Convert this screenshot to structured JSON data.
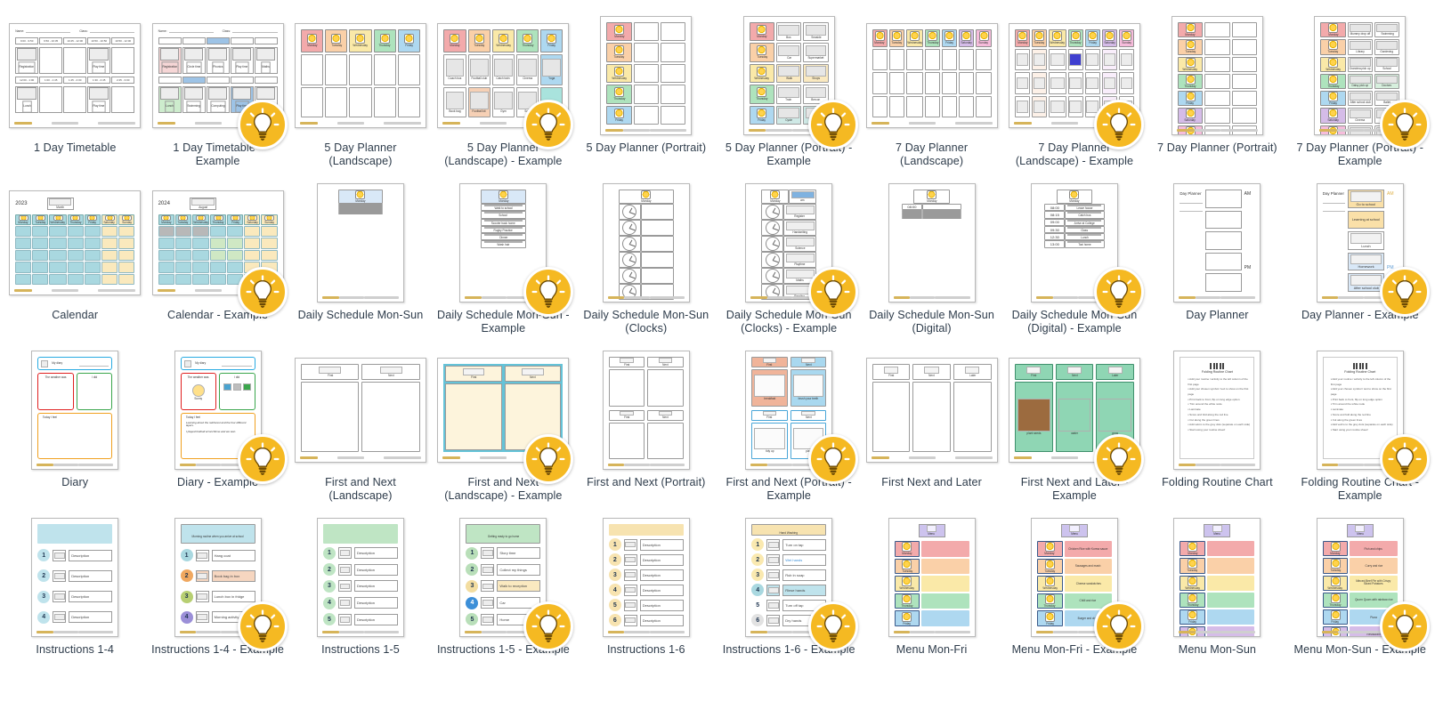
{
  "gallery": {
    "view": "template-thumbnail-grid",
    "columns": 10,
    "example_badge_icon": "lightbulb-icon",
    "items": [
      {
        "caption": "1 Day Timetable",
        "orientation": "landscape",
        "kind": "timetable",
        "example": false,
        "fields": {
          "name_label": "Name:",
          "class_label": "Class:",
          "time_slots_row1": [
            "9:00 - 9:50",
            "9:50 - 10:35",
            "10:45 - 12:00",
            "10:50 - 10:50",
            "10:50 - 12:00"
          ],
          "time_slots_row2": [
            "12:00 - 1:00",
            "1:00 - 1:45",
            "1:45 - 2:30",
            "1:30 - 2:45",
            "2:45 - 3:00"
          ],
          "cells_row1": [
            "Registration",
            "",
            "",
            "Play time",
            ""
          ],
          "cells_row2": [
            "Lunch",
            "",
            "",
            "Play time",
            ""
          ]
        }
      },
      {
        "caption": "1 Day Timetable - Example",
        "orientation": "landscape",
        "kind": "timetable",
        "example": true,
        "fields": {
          "name_label": "Name:",
          "class_label": "Class:",
          "cells_row1": [
            "Registration",
            "Circle time",
            "Phonics",
            "Play time",
            "Maths"
          ],
          "cells_row2": [
            "Lunch",
            "Swimming",
            "Computing",
            "Play time",
            "PE"
          ]
        }
      },
      {
        "caption": "5 Day Planner (Landscape)",
        "orientation": "landscape",
        "kind": "planner5-land",
        "example": false,
        "fields": {
          "days": [
            "Monday",
            "Tuesday",
            "Wednesday",
            "Thursday",
            "Friday"
          ],
          "rows": 2
        }
      },
      {
        "caption": "5 Day Planner (Landscape) - Example",
        "orientation": "landscape",
        "kind": "planner5-land",
        "example": true,
        "fields": {
          "days": [
            "Monday",
            "Tuesday",
            "Wednesday",
            "Thursday",
            "Friday"
          ],
          "rows": 2,
          "entries_row1": [
            "Coach bus",
            "Football club",
            "Catch train",
            "Cinema",
            "Yoga"
          ],
          "entries_row2": [
            "Book bag",
            "Football kit",
            "Gym",
            "Swim",
            ""
          ]
        }
      },
      {
        "caption": "5 Day Planner (Portrait)",
        "orientation": "portrait",
        "kind": "planner5-port",
        "example": false,
        "fields": {
          "days": [
            "Monday",
            "Tuesday",
            "Wednesday",
            "Thursday",
            "Friday"
          ],
          "cols": 2
        }
      },
      {
        "caption": "5 Day Planner (Portrait) - Example",
        "orientation": "portrait",
        "kind": "planner5-port",
        "example": true,
        "fields": {
          "days": [
            "Monday",
            "Tuesday",
            "Wednesday",
            "Thursday",
            "Friday"
          ],
          "entries": [
            [
              "Bus",
              "Seaside"
            ],
            [
              "Car",
              "Supermarket"
            ],
            [
              "Walk",
              "Shops"
            ],
            [
              "Train",
              "Brecon"
            ],
            [
              "Cycle",
              "Park"
            ]
          ]
        }
      },
      {
        "caption": "7 Day Planner (Landscape)",
        "orientation": "landscape",
        "kind": "planner7-land",
        "example": false,
        "fields": {
          "days": [
            "Monday",
            "Tuesday",
            "Wednesday",
            "Thursday",
            "Friday",
            "Saturday",
            "Sunday"
          ],
          "rows": 3
        }
      },
      {
        "caption": "7 Day Planner (Landscape) - Example",
        "orientation": "landscape",
        "kind": "planner7-land",
        "example": true,
        "fields": {
          "days": [
            "Monday",
            "Tuesday",
            "Wednesday",
            "Thursday",
            "Friday",
            "Saturday",
            "Sunday"
          ],
          "rows": 3
        }
      },
      {
        "caption": "7 Day Planner (Portrait)",
        "orientation": "portrait",
        "kind": "planner7-port",
        "example": false,
        "fields": {
          "days": [
            "Monday",
            "Tuesday",
            "Wednesday",
            "Thursday",
            "Friday",
            "Saturday",
            "Sunday"
          ],
          "cols": 2
        }
      },
      {
        "caption": "7 Day Planner (Portrait) - Example",
        "orientation": "portrait",
        "kind": "planner7-port",
        "example": true,
        "fields": {
          "days": [
            "Monday",
            "Tuesday",
            "Wednesday",
            "Thursday",
            "Friday",
            "Saturday",
            "Sunday"
          ],
          "entries": [
            [
              "Mummy drop off",
              "Swimming"
            ],
            [
              "Library",
              "Gardening"
            ],
            [
              "Grandma pick up",
              "School"
            ],
            [
              "Daisy pick up",
              "Doctors"
            ],
            [
              "After school club",
              "Ballet"
            ],
            [
              "Cinema",
              "Trampoline"
            ],
            [
              "Park",
              "Swim"
            ]
          ]
        }
      },
      {
        "caption": "Calendar",
        "orientation": "landscape",
        "kind": "calendar",
        "example": false,
        "fields": {
          "year": "2023",
          "month_label": "Month",
          "days": [
            "Monday",
            "Tuesday",
            "Wednesday",
            "Thursday",
            "Friday",
            "Saturday",
            "Sunday"
          ],
          "rows": 5
        }
      },
      {
        "caption": "Calendar - Example",
        "orientation": "landscape",
        "kind": "calendar",
        "example": true,
        "fields": {
          "year": "2024",
          "month_label": "August",
          "days": [
            "Monday",
            "Tuesday",
            "Wednesday",
            "Thursday",
            "Friday",
            "Saturday",
            "Sunday"
          ],
          "rows": 5
        }
      },
      {
        "caption": "Daily Schedule Mon-Sun",
        "orientation": "portrait-n",
        "kind": "daily",
        "example": false,
        "fields": {
          "day": "Monday",
          "rows": 6
        }
      },
      {
        "caption": "Daily Schedule Mon-Sun - Example",
        "orientation": "portrait-n",
        "kind": "daily",
        "example": true,
        "fields": {
          "day": "Monday",
          "rows": 6,
          "entries": [
            "Walk to school",
            "School",
            "Scooter back home",
            "Rugby Practice",
            "Dinner",
            "Wash hair"
          ]
        }
      },
      {
        "caption": "Daily Schedule Mon-Sun (Clocks)",
        "orientation": "portrait-n",
        "kind": "daily-clocks",
        "example": false,
        "fields": {
          "day": "Monday",
          "rows": 6
        }
      },
      {
        "caption": "Daily Schedule Mon-Sun (Clocks) - Example",
        "orientation": "portrait-n",
        "kind": "daily-clocks",
        "example": true,
        "fields": {
          "day": "Monday",
          "am_label": "am",
          "rows": 6,
          "entries": [
            "Register",
            "Handwriting",
            "Science",
            "Playtime",
            "Maths",
            "Reading"
          ]
        }
      },
      {
        "caption": "Daily Schedule Mon-Sun (Digital)",
        "orientation": "portrait-n",
        "kind": "daily-digital",
        "example": false,
        "fields": {
          "day": "Monday",
          "times": [
            "08:00",
            "",
            "",
            "",
            "",
            ""
          ]
        }
      },
      {
        "caption": "Daily Schedule Mon-Sun (Digital) - Example",
        "orientation": "portrait-n",
        "kind": "daily-digital",
        "example": true,
        "fields": {
          "day": "Monday",
          "times": [
            "08:00",
            "08:15",
            "09:00",
            "09:30",
            "12:30",
            "13:00"
          ],
          "entries": [
            "Leave house",
            "Catch bus",
            "Arrive at College",
            "Class",
            "Lunch",
            "Taxi home"
          ]
        }
      },
      {
        "caption": "Day Planner",
        "orientation": "portrait-n",
        "kind": "day-planner",
        "example": false,
        "fields": {
          "title": "Day Planner",
          "am_label": "AM",
          "pm_label": "PM",
          "rows": 5
        }
      },
      {
        "caption": "Day Planner - Example",
        "orientation": "portrait-n",
        "kind": "day-planner",
        "example": true,
        "fields": {
          "title": "Day Planner",
          "am_label": "AM",
          "pm_label": "PM",
          "entries": [
            "Go to school",
            "Learning at school",
            "Lunch",
            "Homework",
            "After school club"
          ]
        }
      },
      {
        "caption": "Diary",
        "orientation": "portrait-n",
        "kind": "diary",
        "example": false,
        "fields": {
          "header": [
            "My",
            "diary"
          ],
          "weather_label": "The weather was",
          "i_did_label": "I did",
          "feeling_label": "Today I feel"
        }
      },
      {
        "caption": "Diary - Example",
        "orientation": "portrait-n",
        "kind": "diary",
        "example": true,
        "fields": {
          "header": [
            "My",
            "diary"
          ],
          "weather_value": "Sunny",
          "note1": "Learning about the rainforest and the four different layers.",
          "note2": "I played football at lunchtime and we won."
        }
      },
      {
        "caption": "First and Next (Landscape)",
        "orientation": "landscape",
        "kind": "first-next-land",
        "example": false,
        "fields": {
          "headings": [
            "First",
            "Next"
          ]
        }
      },
      {
        "caption": "First and Next (Landscape) - Example",
        "orientation": "landscape",
        "kind": "first-next-land",
        "example": true,
        "fields": {
          "headings": [
            "First",
            "Next"
          ]
        }
      },
      {
        "caption": "First and Next (Portrait)",
        "orientation": "portrait-n",
        "kind": "first-next-port",
        "example": false,
        "fields": {
          "headings": [
            "First",
            "Next"
          ]
        }
      },
      {
        "caption": "First and Next (Portrait) - Example",
        "orientation": "portrait-n",
        "kind": "first-next-port",
        "example": true,
        "fields": {
          "headings": [
            "First",
            "Next"
          ],
          "entries_top": [
            "breakfast",
            "brush your teeth"
          ],
          "entries_bottom": [
            "tidy up",
            "play"
          ]
        }
      },
      {
        "caption": "First Next and Later",
        "orientation": "landscape",
        "kind": "first-next-later",
        "example": false,
        "fields": {
          "headings": [
            "First",
            "Next",
            "Later"
          ]
        }
      },
      {
        "caption": "First Next and Later - Example",
        "orientation": "landscape",
        "kind": "first-next-later",
        "example": true,
        "fields": {
          "headings": [
            "First",
            "Next",
            "Later"
          ],
          "entries": [
            "plant seeds",
            "water",
            "grow"
          ]
        }
      },
      {
        "caption": "Folding Routine Chart",
        "orientation": "portrait-n",
        "kind": "folding",
        "example": false,
        "fields": {
          "title": "Folding Routine Chart",
          "steps": [
            "Add your routine / activity to the left column of the first page",
            "Add your chosen symbol / text to show on the first page",
            "Print back to front, flip on long edge option",
            "Trim around the white node",
            "Laminate",
            "Score and fold along the red line",
            "Cut along the green lines",
            "Add velcro to the grey dots (separate on each side)",
            "Start using your routine sheet!"
          ]
        }
      },
      {
        "caption": "Folding Routine Chart - Example",
        "orientation": "portrait-n",
        "kind": "folding",
        "example": true,
        "fields": {
          "title": "Folding Routine Chart",
          "steps": [
            "Add your routine / activity to the left column of the first page",
            "Add your chosen symbol / text to show on the first page",
            "Print back to front, flip on long edge option",
            "Trim around the white node",
            "Laminate",
            "Score and fold along the red line",
            "Cut along the green lines",
            "Add velcro to the grey dots (separate on each side)",
            "Start using your routine sheet!"
          ]
        }
      },
      {
        "caption": "Instructions 1-4",
        "orientation": "portrait-n",
        "kind": "instructions",
        "example": false,
        "fields": {
          "count": 4,
          "banner": "",
          "accent": "#bfe3ec",
          "numbers": [
            "1",
            "2",
            "3",
            "4"
          ],
          "desc": [
            "Description",
            "Description",
            "Description",
            "Description"
          ]
        }
      },
      {
        "caption": "Instructions 1-4 - Example",
        "orientation": "portrait-n",
        "kind": "instructions",
        "example": true,
        "fields": {
          "count": 4,
          "banner": "Morning routine when you arrive at school",
          "accent": "#bfe3ec",
          "numbers": [
            "1",
            "2",
            "3",
            "4"
          ],
          "desc": [
            "Hang coat",
            "Book bag in box",
            "Lunch box in fridge",
            "Morning activity"
          ]
        }
      },
      {
        "caption": "Instructions 1-5",
        "orientation": "portrait-n",
        "kind": "instructions",
        "example": false,
        "fields": {
          "count": 5,
          "banner": "",
          "accent": "#bfe5c4",
          "numbers": [
            "1",
            "2",
            "3",
            "4",
            "5"
          ],
          "desc": [
            "Description",
            "Description",
            "Description",
            "Description",
            "Description"
          ]
        }
      },
      {
        "caption": "Instructions 1-5 - Example",
        "orientation": "portrait-n",
        "kind": "instructions",
        "example": true,
        "fields": {
          "count": 5,
          "banner": "Getting ready to go home",
          "accent": "#bfe5c4",
          "numbers": [
            "1",
            "2",
            "3",
            "4",
            "5"
          ],
          "desc": [
            "Story time",
            "Collect my things",
            "Walk to reception",
            "Car",
            "Home"
          ]
        }
      },
      {
        "caption": "Instructions 1-6",
        "orientation": "portrait-n",
        "kind": "instructions",
        "example": false,
        "fields": {
          "count": 6,
          "banner": "",
          "accent": "#f7e3b0",
          "numbers": [
            "1",
            "2",
            "3",
            "4",
            "5",
            "6"
          ],
          "desc": [
            "Description",
            "Description",
            "Description",
            "Description",
            "Description",
            "Description"
          ]
        }
      },
      {
        "caption": "Instructions 1-6 - Example",
        "orientation": "portrait-n",
        "kind": "instructions",
        "example": true,
        "fields": {
          "count": 6,
          "banner": "Hand Washing",
          "accent": "#f7e3b0",
          "numbers": [
            "1",
            "2",
            "3",
            "4",
            "5",
            "6"
          ],
          "desc": [
            "Turn on tap",
            "Wet hands",
            "Rub in soap",
            "Rinse hands",
            "Turn off tap",
            "Dry hands"
          ]
        }
      },
      {
        "caption": "Menu Mon-Fri",
        "orientation": "portrait-n",
        "kind": "menu",
        "example": false,
        "fields": {
          "title": "Menu",
          "days": [
            "Monday",
            "Tuesday",
            "Wednesday",
            "Thursday",
            "Friday"
          ]
        }
      },
      {
        "caption": "Menu Mon-Fri - Example",
        "orientation": "portrait-n",
        "kind": "menu",
        "example": true,
        "fields": {
          "title": "Menu",
          "days": [
            "Monday",
            "Tuesday",
            "Wednesday",
            "Thursday",
            "Friday"
          ],
          "entries": [
            "Chicken Rice with Korma sauce",
            "Sausages and mash",
            "Cheese sandwiches",
            "Chilli and rice",
            "Burger and chips"
          ]
        }
      },
      {
        "caption": "Menu Mon-Sun",
        "orientation": "portrait-n",
        "kind": "menu7",
        "example": false,
        "fields": {
          "title": "Menu",
          "days": [
            "Monday",
            "Tuesday",
            "Wednesday",
            "Thursday",
            "Friday",
            "Saturday",
            "Sunday"
          ]
        }
      },
      {
        "caption": "Menu Mon-Sun - Example",
        "orientation": "portrait-n",
        "kind": "menu7",
        "example": true,
        "fields": {
          "title": "Menu",
          "days": [
            "Monday",
            "Tuesday",
            "Wednesday",
            "Thursday",
            "Friday",
            "Saturday",
            "Sunday"
          ],
          "entries": [
            "Fish and chips",
            "Curry and rice",
            "Minced Beef Pie with Crispy Sliced Potatoes",
            "Quorn Quorn with rainbow rice",
            "Pizza",
            "Restaurant",
            "Lasagne or Roast"
          ]
        }
      }
    ]
  },
  "colors": {
    "day_monday": "#f3aaab",
    "day_tuesday": "#fad0a8",
    "day_wednesday": "#fae9a8",
    "day_thursday": "#aee3bd",
    "day_friday": "#aed8f0",
    "day_saturday": "#d5bce8",
    "day_sunday": "#f6bcdb",
    "badge": "#f5b922",
    "caption_text": "#2e3c4b"
  }
}
